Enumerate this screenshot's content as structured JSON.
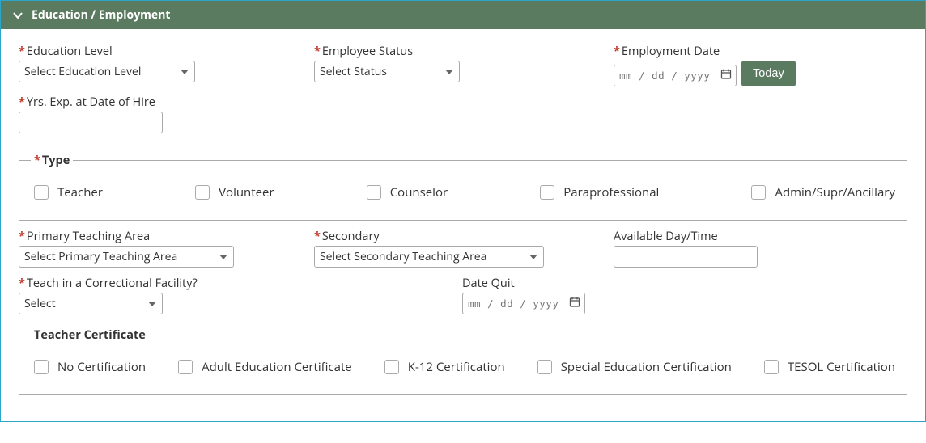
{
  "header": {
    "title": "Education / Employment"
  },
  "fields": {
    "education_level": {
      "label": "Education Level",
      "placeholder": "Select Education Level"
    },
    "employee_status": {
      "label": "Employee Status",
      "placeholder": "Select Status"
    },
    "employment_date": {
      "label": "Employment Date",
      "placeholder": "mm / dd / yyyy"
    },
    "today_button": "Today",
    "yrs_exp": {
      "label": "Yrs. Exp. at Date of Hire",
      "value": ""
    },
    "primary_teaching_area": {
      "label": "Primary Teaching Area",
      "placeholder": "Select Primary Teaching Area"
    },
    "secondary_teaching_area": {
      "label": "Secondary",
      "placeholder": "Select Secondary Teaching Area"
    },
    "available_day_time": {
      "label": "Available Day/Time",
      "value": ""
    },
    "teach_correctional": {
      "label": "Teach in a Correctional Facility?",
      "placeholder": "Select"
    },
    "date_quit": {
      "label": "Date Quit",
      "placeholder": "mm / dd / yyyy"
    }
  },
  "type_group": {
    "legend": "Type",
    "options": [
      "Teacher",
      "Volunteer",
      "Counselor",
      "Paraprofessional",
      "Admin/Supr/Ancillary"
    ]
  },
  "cert_group": {
    "legend": "Teacher Certificate",
    "options": [
      "No Certification",
      "Adult Education Certificate",
      "K-12 Certification",
      "Special Education Certification",
      "TESOL Certification"
    ]
  }
}
